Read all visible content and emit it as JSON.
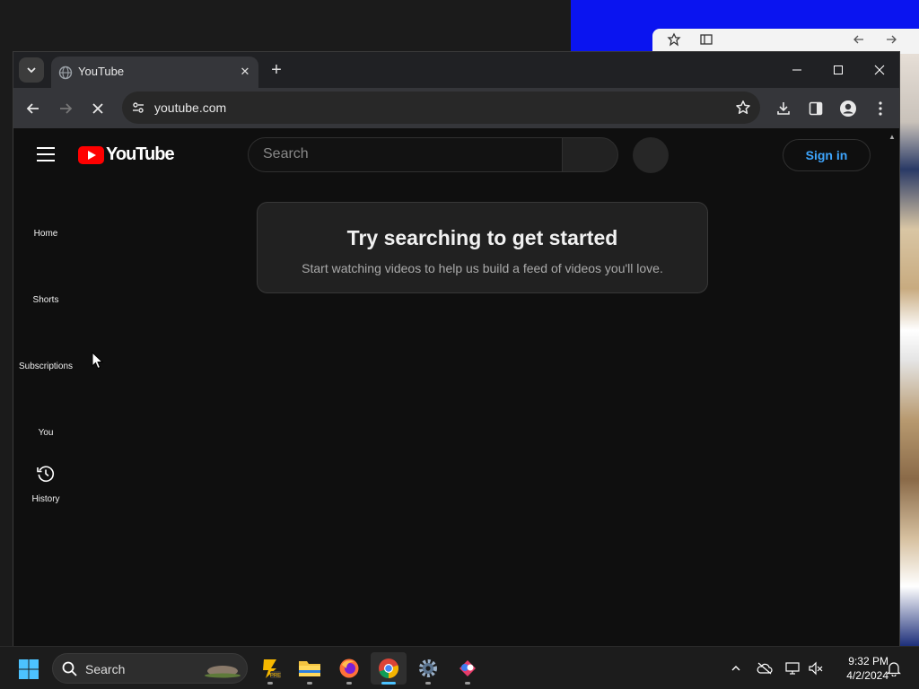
{
  "browser": {
    "tab_title": "YouTube",
    "url": "youtube.com"
  },
  "youtube": {
    "logo_text": "YouTube",
    "search_placeholder": "Search",
    "sign_in_label": "Sign in",
    "nav": [
      {
        "label": "Home"
      },
      {
        "label": "Shorts"
      },
      {
        "label": "Subscriptions"
      },
      {
        "label": "You"
      },
      {
        "label": "History"
      }
    ],
    "prompt": {
      "title": "Try searching to get started",
      "subtitle": "Start watching videos to help us build a feed of videos you'll love."
    }
  },
  "taskbar": {
    "search_label": "Search",
    "time": "9:32 PM",
    "date": "4/2/2024"
  },
  "colors": {
    "accent_blue": "#3ea6ff",
    "yt_red": "#ff0000",
    "page_bg": "#0f0f0f"
  }
}
